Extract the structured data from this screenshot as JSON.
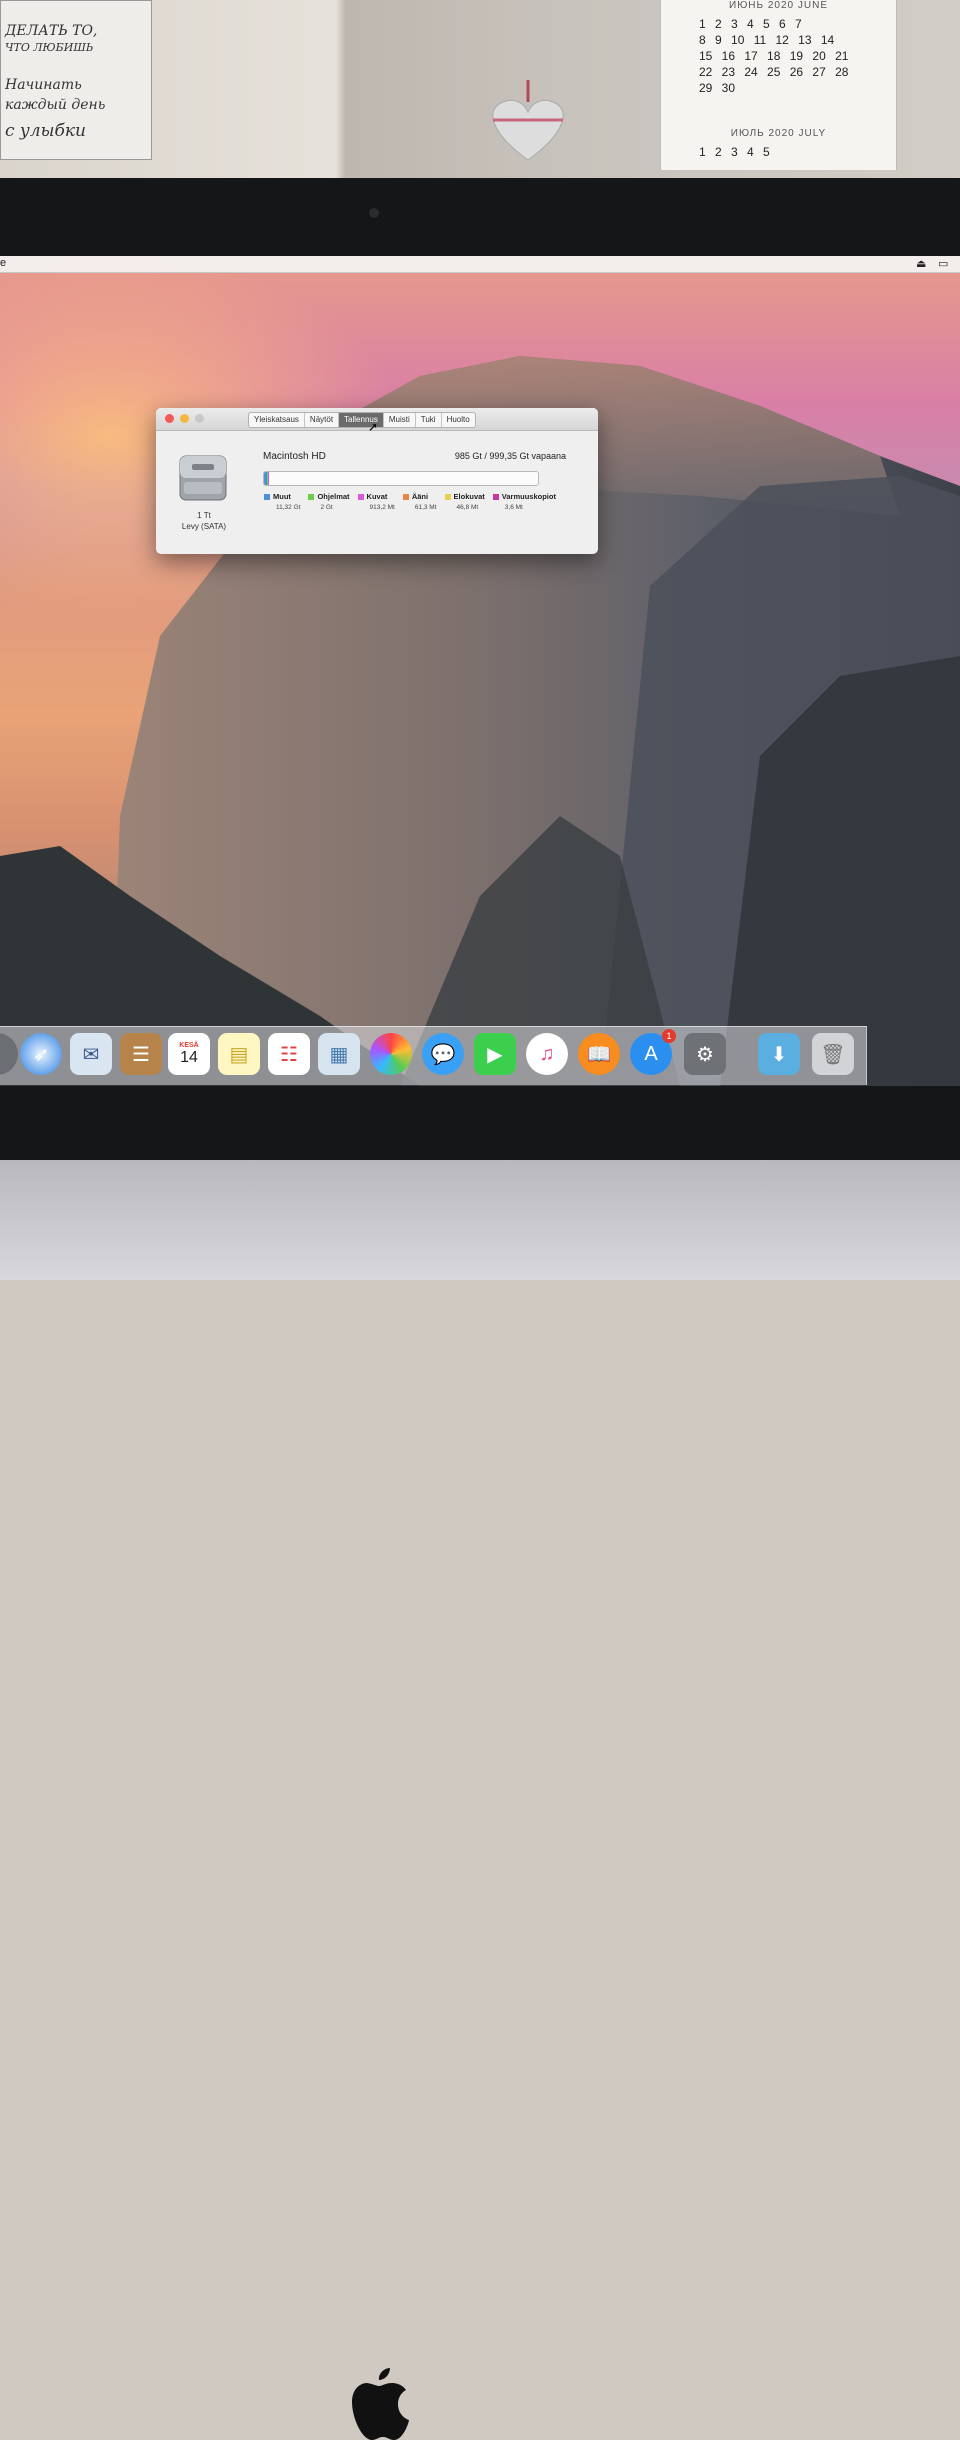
{
  "room": {
    "poster_lines": [
      "ДЕЛАТЬ ТО,",
      "ЧТО ЛЮБИШЬ",
      "Начинать",
      "каждый день",
      "с улыбки"
    ],
    "calendar": {
      "month_top": "ИЮНЬ  2020  JUNE",
      "rows_top": [
        "1  2  3  4  5  6  7",
        "8  9  10  11  12  13  14",
        "15  16  17  18  19  20  21",
        "22  23  24  25  26  27  28",
        "29  30"
      ],
      "month_bottom": "ИЮЛЬ  2020  JULY",
      "rows_bottom": [
        "1  2  3  4  5"
      ]
    }
  },
  "window": {
    "tabs": [
      {
        "label": "Yleiskatsaus",
        "active": false
      },
      {
        "label": "Näytöt",
        "active": false
      },
      {
        "label": "Tallennus",
        "active": true
      },
      {
        "label": "Muisti",
        "active": false
      },
      {
        "label": "Tuki",
        "active": false
      },
      {
        "label": "Huolto",
        "active": false
      }
    ],
    "disk": {
      "size": "1 Tt",
      "type": "Levy (SATA)"
    },
    "volume": {
      "name": "Macintosh HD",
      "free": "985 Gt / 999,35 Gt vapaana"
    },
    "storage": [
      {
        "label": "Muut",
        "value": "11,32 Gt",
        "color": "#4a8fe0"
      },
      {
        "label": "Ohjelmat",
        "value": "2 Gt",
        "color": "#6ccf4a"
      },
      {
        "label": "Kuvat",
        "value": "913,2 Mt",
        "color": "#d85ad8"
      },
      {
        "label": "Ääni",
        "value": "61,3 Mt",
        "color": "#e8874a"
      },
      {
        "label": "Elokuvat",
        "value": "46,8 Mt",
        "color": "#e7d14a"
      },
      {
        "label": "Varmuuskopiot",
        "value": "3,6 Mt",
        "color": "#c43aa0"
      }
    ]
  },
  "dock": {
    "calendar_month": "KESÄ",
    "calendar_day": "14",
    "app_store_badge": "1"
  }
}
